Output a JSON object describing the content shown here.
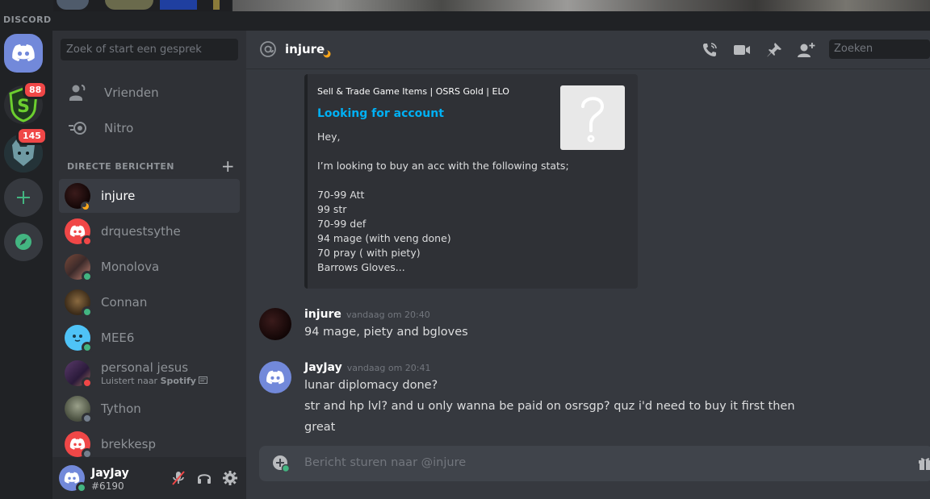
{
  "app": {
    "brand": "DISCORD"
  },
  "guilds": {
    "server1_badge": "88",
    "server2_badge": "145"
  },
  "dm_sidebar": {
    "search_placeholder": "Zoek of start een gesprek",
    "nav": [
      {
        "label": "Vrienden",
        "icon": "friends-icon"
      },
      {
        "label": "Nitro",
        "icon": "nitro-icon"
      }
    ],
    "section_header": "DIRECTE BERICHTEN",
    "dms": [
      {
        "name": "injure",
        "status": "idle",
        "active": true
      },
      {
        "name": "drquestsythe",
        "status": "dnd"
      },
      {
        "name": "Monolova",
        "status": "online"
      },
      {
        "name": "Connan",
        "status": "online"
      },
      {
        "name": "MEE6",
        "status": "online"
      },
      {
        "name": "personal jesus",
        "status": "dnd",
        "activity_prefix": "Luistert naar",
        "activity_app": "Spotify"
      },
      {
        "name": "Tython",
        "status": "offline"
      },
      {
        "name": "brekkesp",
        "status": "offline"
      }
    ]
  },
  "user_panel": {
    "username": "JayJay",
    "tag": "#6190"
  },
  "chat": {
    "header_name": "injure",
    "search_placeholder": "Zoeken",
    "embed": {
      "author": "Sell & Trade Game Items | OSRS Gold | ELO",
      "title": "Looking for account",
      "lines": [
        "Hey,",
        "",
        "I’m looking to buy an acc with the following stats;",
        "",
        "70-99 Att",
        "99 str",
        "70-99 def",
        "94 mage (with veng done)",
        "70 pray ( with piety)",
        "Barrows Gloves..."
      ]
    },
    "messages": [
      {
        "author": "injure",
        "time": "vandaag om 20:40",
        "lines": [
          "94 mage, piety and bgloves"
        ]
      },
      {
        "author": "JayJay",
        "time": "vandaag om 20:41",
        "lines": [
          "lunar diplomacy done?",
          "str and hp lvl? and u only wanna be paid on osrsgp? quz i'd need to buy it first then",
          "great"
        ]
      }
    ],
    "input_placeholder": "Bericht sturen naar @injure"
  },
  "colors": {
    "blurple": "#7289da",
    "online": "#43b581",
    "dnd": "#f04747",
    "idle": "#faa61a",
    "link": "#00b0f4"
  }
}
